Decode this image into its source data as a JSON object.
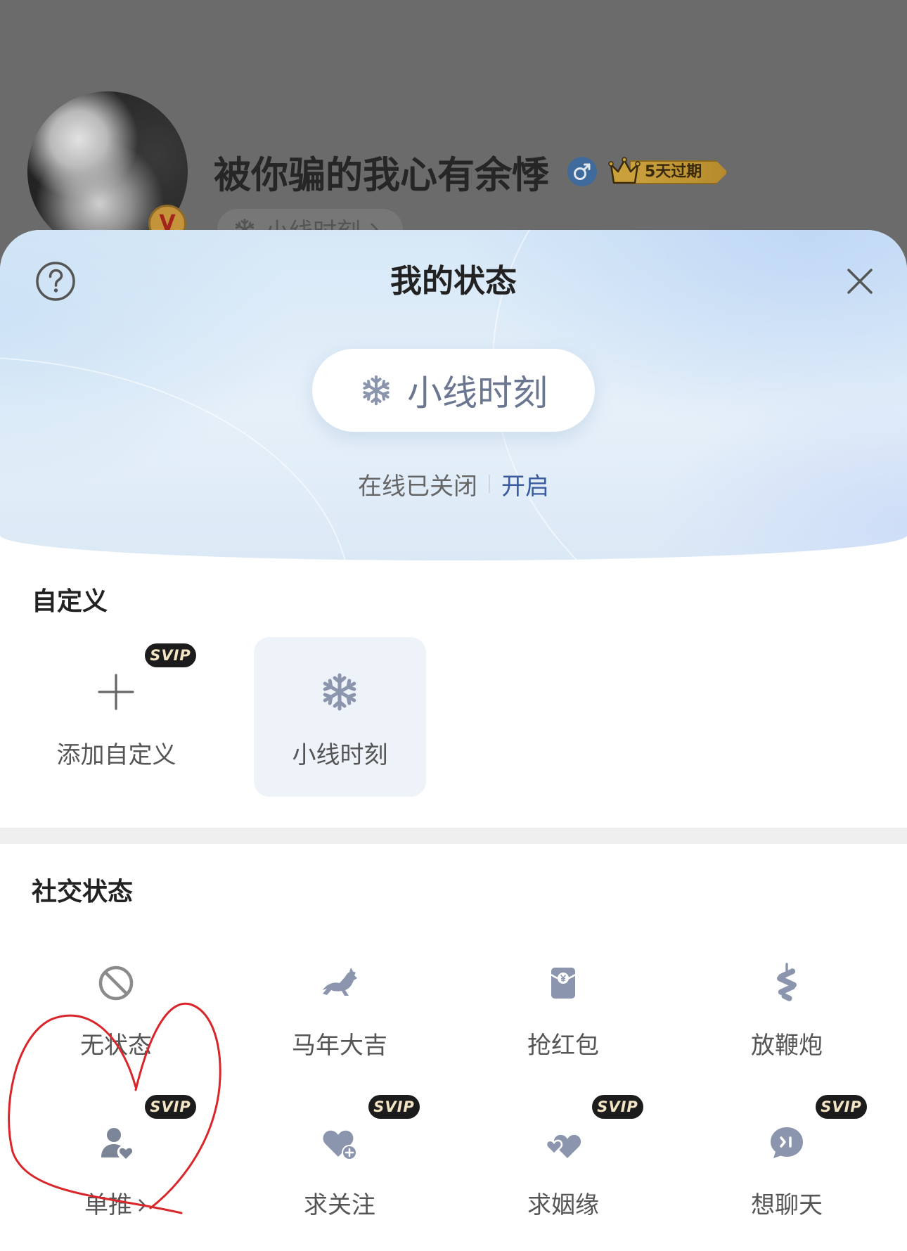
{
  "profile": {
    "username": "被你骗的我心有余悸",
    "avatar_badge": "V",
    "membership_badge": "5天过期",
    "status_pill": "小线时刻"
  },
  "sheet": {
    "title": "我的状态",
    "current_status": {
      "label": "小线时刻",
      "icon": "snowflake-icon"
    },
    "online": {
      "status_text": "在线已关闭",
      "action_label": "开启"
    }
  },
  "custom": {
    "title": "自定义",
    "items": [
      {
        "label": "添加自定义",
        "icon": "plus-icon",
        "badge": "SVIP"
      },
      {
        "label": "小线时刻",
        "icon": "snowflake-icon",
        "selected": true
      }
    ]
  },
  "social": {
    "title": "社交状态",
    "items": [
      {
        "label": "无状态",
        "icon": "ban-icon"
      },
      {
        "label": "马年大吉",
        "icon": "horse-icon"
      },
      {
        "label": "抢红包",
        "icon": "red-envelope-icon"
      },
      {
        "label": "放鞭炮",
        "icon": "firecracker-icon"
      },
      {
        "label": "单推",
        "icon": "person-heart-icon",
        "badge": "SVIP"
      },
      {
        "label": "求关注",
        "icon": "heart-plus-icon",
        "badge": "SVIP"
      },
      {
        "label": "求姻缘",
        "icon": "double-heart-icon",
        "badge": "SVIP"
      },
      {
        "label": "想聊天",
        "icon": "chat-bubble-icon",
        "badge": "SVIP"
      }
    ]
  },
  "colors": {
    "accent_blue": "#3b5ba0",
    "icon_gray_blue": "#8b96ae",
    "selected_tile_bg": "#eef3fa",
    "svip_badge_bg": "#1c1c1c",
    "annotation_red": "#d9262b"
  }
}
